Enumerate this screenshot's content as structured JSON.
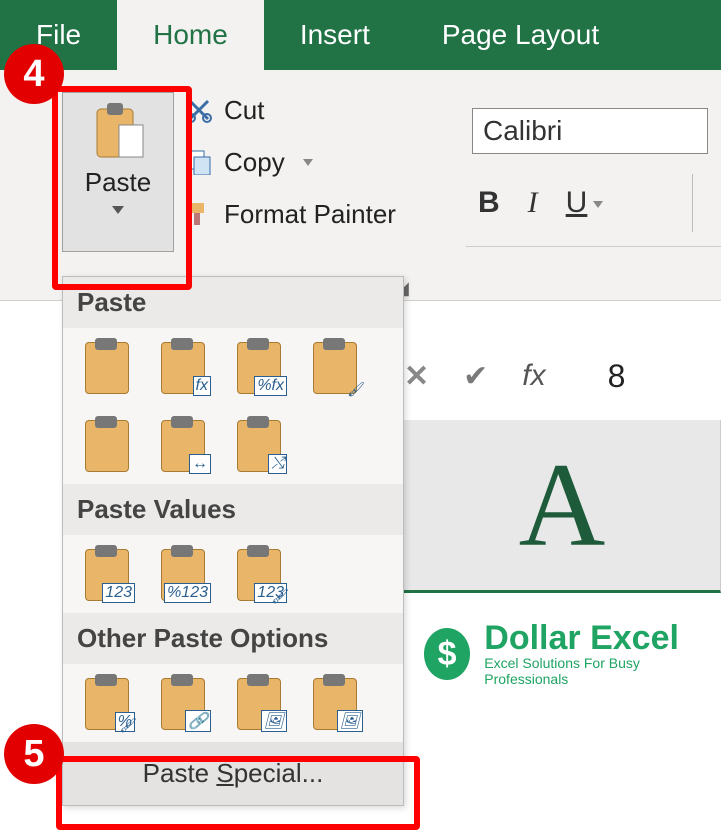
{
  "tabs": {
    "file": "File",
    "home": "Home",
    "insert": "Insert",
    "page_layout": "Page Layout",
    "active": "home"
  },
  "clipboard": {
    "paste": "Paste",
    "cut": "Cut",
    "copy": "Copy",
    "format_painter": "Format Painter"
  },
  "font": {
    "name": "Calibri",
    "bold": "B",
    "italic": "I",
    "underline": "U"
  },
  "formula_bar": {
    "value": "8"
  },
  "column_header": "A",
  "brand": {
    "symbol": "$",
    "title": "Dollar Excel",
    "subtitle": "Excel Solutions For Busy Professionals"
  },
  "paste_menu": {
    "sec_paste": "Paste",
    "sec_values": "Paste Values",
    "sec_other": "Other Paste Options",
    "paste_special": "Paste Special...",
    "paste_special_underline": "S",
    "row1": [
      {
        "name": "paste-all-icon",
        "ov": ""
      },
      {
        "name": "paste-formulas-icon",
        "ov": "fx"
      },
      {
        "name": "paste-formulas-number-icon",
        "ov": "%fx"
      },
      {
        "name": "paste-keep-source-icon",
        "ov": "",
        "brush": true
      }
    ],
    "row2": [
      {
        "name": "paste-no-borders-icon",
        "ov": ""
      },
      {
        "name": "paste-keep-width-icon",
        "ov": "↔"
      },
      {
        "name": "paste-transpose-icon",
        "ov": "⤭"
      }
    ],
    "rowv": [
      {
        "name": "paste-values-icon",
        "ov": "123"
      },
      {
        "name": "paste-values-number-icon",
        "ov": "%123"
      },
      {
        "name": "paste-values-source-icon",
        "ov": "123",
        "brush": true
      }
    ],
    "rowo": [
      {
        "name": "paste-formatting-icon",
        "ov": "%",
        "brush": true
      },
      {
        "name": "paste-link-icon",
        "ov": "🔗"
      },
      {
        "name": "paste-picture-icon",
        "ov": "🖼"
      },
      {
        "name": "paste-linked-picture-icon",
        "ov": "🖼"
      }
    ]
  },
  "callouts": {
    "c4": "4",
    "c5": "5"
  }
}
